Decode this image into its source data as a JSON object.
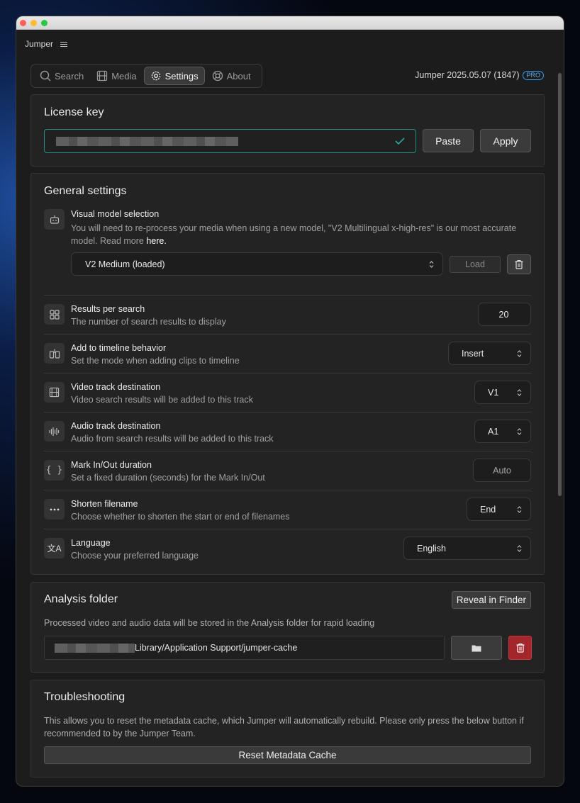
{
  "app": {
    "title": "Jumper",
    "version": "Jumper 2025.05.07 (1847)",
    "badge": "PRO"
  },
  "tabs": [
    {
      "label": "Search",
      "icon": "search-icon"
    },
    {
      "label": "Media",
      "icon": "film-icon"
    },
    {
      "label": "Settings",
      "icon": "gear-icon",
      "active": true
    },
    {
      "label": "About",
      "icon": "lifebuoy-icon"
    }
  ],
  "license": {
    "title": "License key",
    "paste": "Paste",
    "apply": "Apply"
  },
  "general": {
    "title": "General settings",
    "visual": {
      "title": "Visual model selection",
      "desc": "You will need to re-process your media when using a new model, \"V2 Multilingual x-high-res\" is our most accurate model.",
      "read_more": "Read more",
      "here": "here.",
      "model": "V2 Medium (loaded)",
      "load": "Load"
    },
    "rows": [
      {
        "title": "Results per search",
        "desc": "The number of search results to display",
        "value": "20"
      },
      {
        "title": "Add to timeline behavior",
        "desc": "Set the mode when adding clips to timeline",
        "value": "Insert"
      },
      {
        "title": "Video track destination",
        "desc": "Video search results will be added to this track",
        "value": "V1"
      },
      {
        "title": "Audio track destination",
        "desc": "Audio from search results will be added to this track",
        "value": "A1"
      },
      {
        "title": "Mark In/Out duration",
        "desc": "Set a fixed duration (seconds) for the Mark In/Out",
        "value": "Auto"
      },
      {
        "title": "Shorten filename",
        "desc": "Choose whether to shorten the start or end of filenames",
        "value": "End"
      },
      {
        "title": "Language",
        "desc": "Choose your preferred language",
        "value": "English"
      }
    ]
  },
  "analysis": {
    "title": "Analysis folder",
    "reveal": "Reveal in Finder",
    "desc": "Processed video and audio data will be stored in the Analysis folder for rapid loading",
    "path": "Library/Application Support/jumper-cache"
  },
  "troubleshooting": {
    "title": "Troubleshooting",
    "desc": "This allows you to reset the metadata cache, which Jumper will automatically rebuild. Please only press the below button if recommended to by the Jumper Team.",
    "reset": "Reset Metadata Cache"
  },
  "colors": {
    "accent": "#1f8f86",
    "danger": "#a3262a",
    "pro": "#3aa0f0"
  }
}
